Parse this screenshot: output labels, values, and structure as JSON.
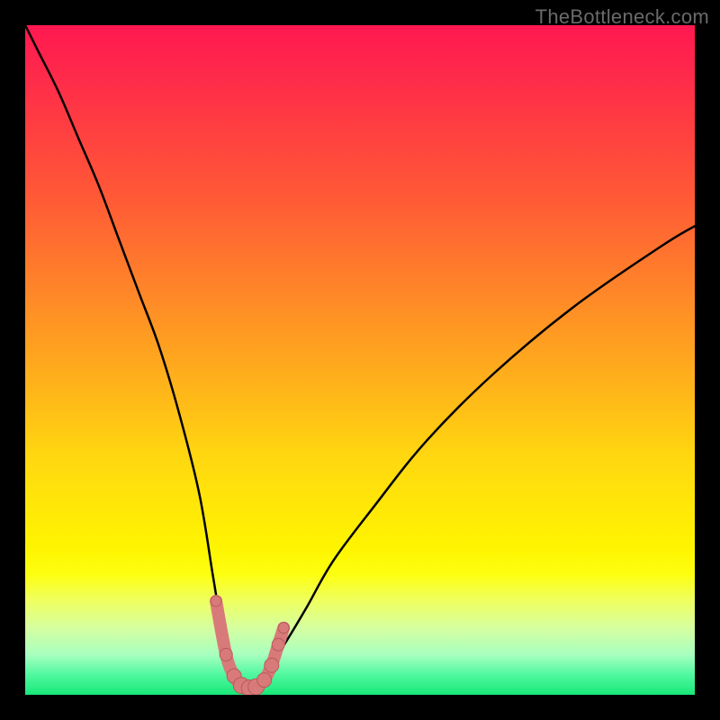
{
  "watermark": "TheBottleneck.com",
  "colors": {
    "page_bg": "#000000",
    "gradient_top": "#ff1850",
    "gradient_mid": "#ffe808",
    "gradient_bottom": "#18e878",
    "curve_stroke": "#000000",
    "marker_fill": "#d97a7a",
    "marker_stroke": "#b85a5a"
  },
  "chart_data": {
    "type": "line",
    "title": "",
    "xlabel": "",
    "ylabel": "",
    "xlim": [
      0,
      100
    ],
    "ylim": [
      0,
      100
    ],
    "grid": false,
    "legend": false,
    "series": [
      {
        "name": "bottleneck-curve",
        "x": [
          0,
          2,
          5,
          8,
          11,
          14,
          17,
          20,
          23,
          26,
          28,
          29,
          30,
          31,
          32,
          33,
          34,
          35,
          36,
          37,
          39,
          42,
          46,
          52,
          60,
          70,
          82,
          95,
          100
        ],
        "values": [
          100,
          96,
          90,
          83,
          76,
          68,
          60,
          52,
          42,
          30,
          18,
          12,
          7,
          4,
          2,
          1,
          1,
          2,
          3,
          5,
          8,
          13,
          20,
          28,
          38,
          48,
          58,
          67,
          70
        ]
      }
    ],
    "markers": {
      "name": "highlight-dots",
      "x": [
        28.5,
        30.0,
        31.2,
        32.3,
        33.5,
        34.5,
        35.7,
        36.8,
        37.8,
        38.6
      ],
      "values": [
        14.0,
        6.0,
        2.8,
        1.4,
        1.0,
        1.2,
        2.2,
        4.4,
        7.5,
        10.0
      ],
      "radius": [
        6,
        7,
        8,
        9,
        9,
        9,
        8,
        8,
        7,
        6
      ]
    }
  }
}
